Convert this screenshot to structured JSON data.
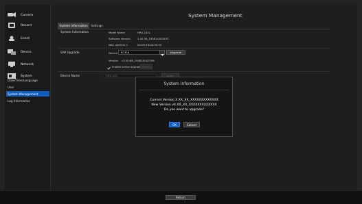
{
  "sidebar": {
    "items": [
      {
        "label": "Camera",
        "icon": "camera-icon"
      },
      {
        "label": "Record",
        "icon": "record-icon"
      },
      {
        "label": "Event",
        "icon": "event-icon"
      },
      {
        "label": "Device",
        "icon": "device-icon"
      },
      {
        "label": "Network",
        "icon": "network-icon"
      },
      {
        "label": "System",
        "icon": "system-icon"
      }
    ],
    "subitems": [
      {
        "label": "Date/Time/Language"
      },
      {
        "label": "User"
      },
      {
        "label": "System Management"
      },
      {
        "label": "Log Information"
      }
    ],
    "active_subitem": "System Management"
  },
  "header": {
    "title": "System Management"
  },
  "tabs": [
    {
      "label": "System Information",
      "active": true
    },
    {
      "label": "Settings",
      "active": false
    }
  ],
  "system_info": {
    "section_label": "System Information",
    "rows": [
      {
        "label": "Model Name",
        "value": "HRX-1621"
      },
      {
        "label": "Software Version",
        "value": "3.00.58_190814181833"
      },
      {
        "label": "MAC address 1",
        "value": "00:09:18:00:00:92"
      }
    ]
  },
  "sw_upgrade": {
    "section_label": "S/W Upgrade",
    "device_label": "Device",
    "device_value": "R-TICK",
    "upgrade_button": "Upgrade",
    "version_label": "Version",
    "version_value": "v3.00.68_190820042356",
    "online_label": "Enable online upgrade",
    "online_checked": true,
    "online_button": "Search"
  },
  "device_name": {
    "label": "Device Name",
    "value": "HRX-1621",
    "apply_button": "Apply"
  },
  "dialog": {
    "title": "System Information",
    "current_version": "Current Version X.XX_XX_XXXXXXXXXXXXX",
    "new_version": "New Version vX.XX_XX_XXXXXXXXXXXXX",
    "question": "Do you want to upgrade?",
    "ok_label": "OK",
    "cancel_label": "Cancel"
  },
  "footer": {
    "return_label": "Return"
  },
  "colors": {
    "accent": "#0f5fbf",
    "background": "#1e1e1e",
    "sidebar_bg": "#1a1a1a",
    "text": "#e6e6e6"
  }
}
